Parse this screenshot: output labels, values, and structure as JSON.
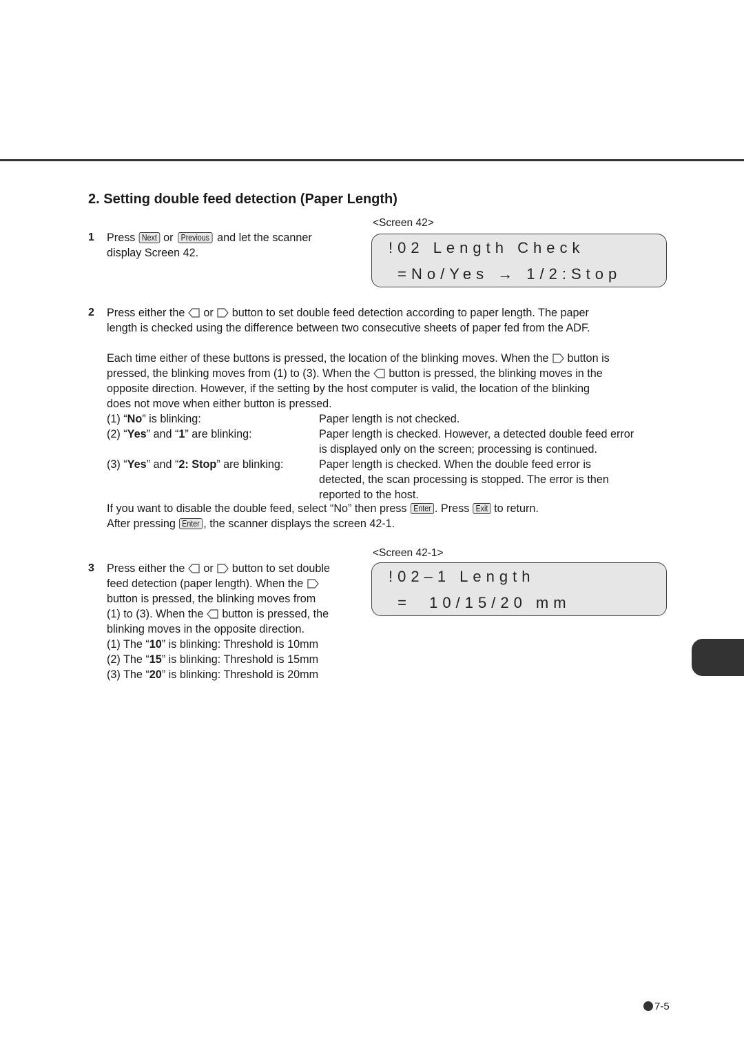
{
  "section_title": "2.  Setting double feed detection (Paper Length)",
  "step1": {
    "number": "1",
    "text_a": "Press ",
    "key_next": "Next",
    "text_b": " or ",
    "key_previous": "Previous",
    "text_c": " and let the scanner",
    "line2": "display Screen 42."
  },
  "screen42": {
    "caption": "<Screen 42>",
    "line1": "!02 Length Check",
    "line2": " =No/Yes → 1/2:Stop"
  },
  "step2": {
    "number": "2",
    "p1_a": "Press either the ",
    "p1_b": " or ",
    "p1_c": " button to set double feed detection according to paper length.  The paper",
    "p1_line2": "length is checked using the difference between two consecutive sheets of paper fed from the ADF.",
    "p2_l1_a": "Each time either of these buttons is pressed, the location of the blinking moves. When the ",
    "p2_l1_b": " button is",
    "p2_l2_a": "pressed, the blinking moves from (1) to (3). When the ",
    "p2_l2_b": " button is pressed, the  blinking moves in the",
    "p2_l3": "opposite direction. However, if the setting by the host computer is valid, the location of the blinking",
    "p2_l4": "does not move when either button is pressed.",
    "options": [
      {
        "pre": "(1) “",
        "bold1": "No",
        "mid": "” is blinking:",
        "bold2": "",
        "post": "",
        "desc": [
          "Paper length is not checked."
        ]
      },
      {
        "pre": "(2) “",
        "bold1": "Yes",
        "mid": "” and “",
        "bold2": "1",
        "post": "” are blinking:",
        "desc": [
          "Paper length is checked.  However, a detected double feed error",
          "is displayed only on the screen; processing is continued."
        ]
      },
      {
        "pre": "(3) “",
        "bold1": "Yes",
        "mid": "” and “",
        "bold2": "2: Stop",
        "post": "” are blinking:",
        "desc": [
          "Paper length is checked.  When the double feed error is",
          "detected, the scan processing is stopped.  The error is then",
          "reported to the host."
        ]
      }
    ],
    "disable_a": "If you want to disable the double feed, select “No” then press ",
    "key_enter": "Enter",
    "disable_b": ". Press ",
    "key_exit": "Exit",
    "disable_c": " to return.",
    "after_a": "After pressing ",
    "after_b": ", the scanner displays the screen 42-1."
  },
  "screen42_1": {
    "caption": "<Screen 42-1>",
    "line1": "!02–1 Length",
    "line2": " =  10/15/20 mm"
  },
  "step3": {
    "number": "3",
    "l1_a": "Press either the ",
    "l1_b": " or ",
    "l1_c": " button to set double",
    "l2_a": "feed detection (paper length). When the ",
    "l3": "button is pressed, the blinking moves from",
    "l4_a": "(1) to (3). When the ",
    "l4_b": " button is pressed, the",
    "l5": "blinking moves in the opposite direction.",
    "thresholds": [
      {
        "pre": "(1) The “",
        "bold": "10",
        "post": "” is blinking: Threshold is 10mm"
      },
      {
        "pre": "(2) The “",
        "bold": "15",
        "post": "” is blinking: Threshold is 15mm"
      },
      {
        "pre": "(3) The “",
        "bold": "20",
        "post": "” is blinking: Threshold is 20mm"
      }
    ]
  },
  "page_number": "7-5"
}
